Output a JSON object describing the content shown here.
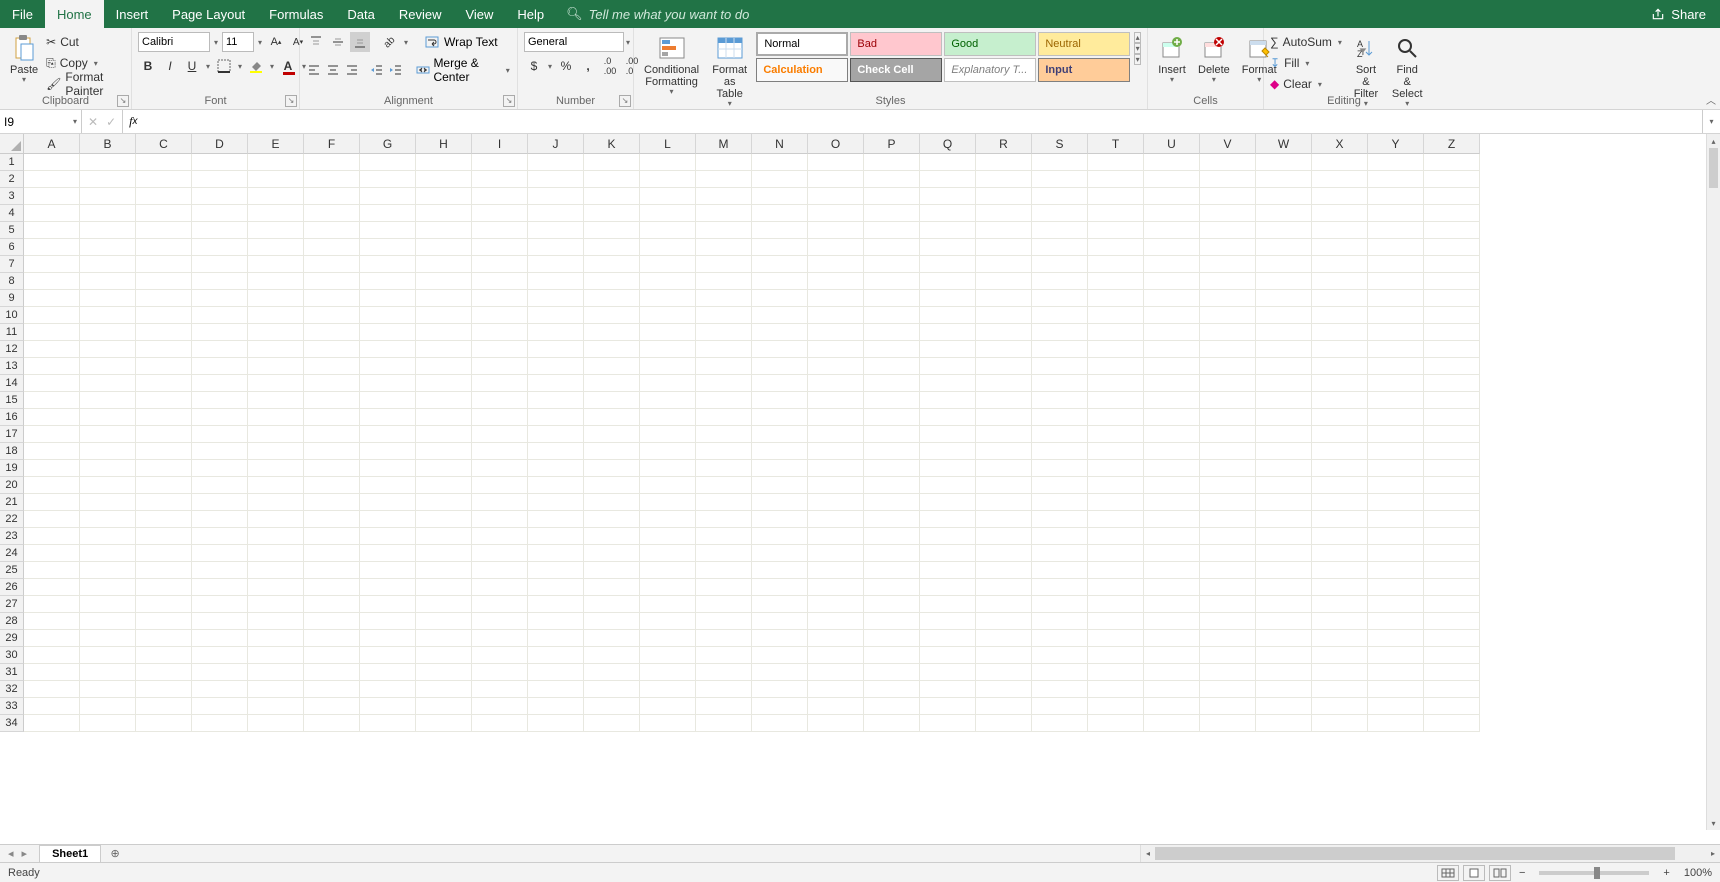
{
  "menu": {
    "tabs": [
      "File",
      "Home",
      "Insert",
      "Page Layout",
      "Formulas",
      "Data",
      "Review",
      "View",
      "Help"
    ],
    "active": "Home",
    "tell_me_placeholder": "Tell me what you want to do",
    "share": "Share"
  },
  "ribbon": {
    "clipboard": {
      "paste": "Paste",
      "cut": "Cut",
      "copy": "Copy",
      "format_painter": "Format Painter",
      "label": "Clipboard"
    },
    "font": {
      "name": "Calibri",
      "size": "11",
      "label": "Font"
    },
    "alignment": {
      "wrap": "Wrap Text",
      "merge": "Merge & Center",
      "label": "Alignment"
    },
    "number": {
      "format": "General",
      "label": "Number"
    },
    "styles": {
      "cond": "Conditional Formatting",
      "fmt_table": "Format as Table",
      "chips": [
        "Normal",
        "Bad",
        "Good",
        "Neutral",
        "Calculation",
        "Check Cell",
        "Explanatory T...",
        "Input"
      ],
      "label": "Styles"
    },
    "cells": {
      "insert": "Insert",
      "delete": "Delete",
      "format": "Format",
      "label": "Cells"
    },
    "editing": {
      "autosum": "AutoSum",
      "fill": "Fill",
      "clear": "Clear",
      "sort": "Sort & Filter",
      "find": "Find & Select",
      "label": "Editing"
    }
  },
  "name_box": "I9",
  "formula": "",
  "columns": [
    "A",
    "B",
    "C",
    "D",
    "E",
    "F",
    "G",
    "H",
    "I",
    "J",
    "K",
    "L",
    "M",
    "N",
    "O",
    "P",
    "Q",
    "R",
    "S",
    "T",
    "U",
    "V",
    "W",
    "X",
    "Y",
    "Z"
  ],
  "rows": [
    1,
    2,
    3,
    4,
    5,
    6,
    7,
    8,
    9,
    10,
    11,
    12,
    13,
    14,
    15,
    16,
    17,
    18,
    19,
    20,
    21,
    22,
    23,
    24,
    25,
    26,
    27,
    28,
    29,
    30,
    31,
    32,
    33,
    34
  ],
  "sheet_tab": "Sheet1",
  "status": "Ready",
  "zoom": "100%"
}
